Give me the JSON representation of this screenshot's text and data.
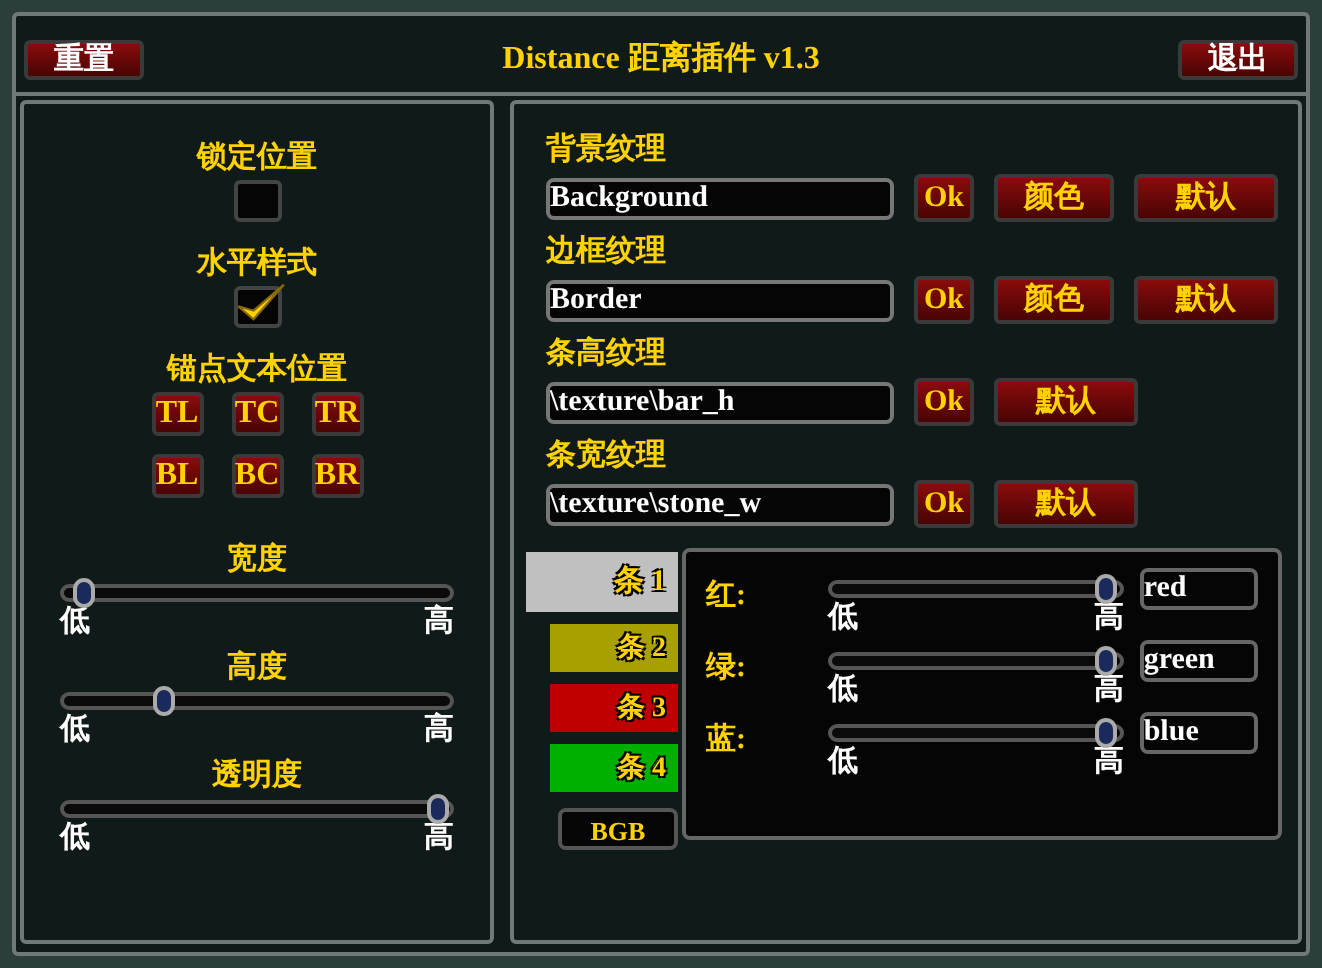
{
  "title": "Distance 距离插件 v1.3",
  "reset_button": "重置",
  "exit_button": "退出",
  "left": {
    "checkboxes": [
      {
        "label": "锁定位置",
        "checked": false
      },
      {
        "label": "水平样式",
        "checked": true
      }
    ],
    "anchor": {
      "label": "锚点文本位置",
      "buttons": [
        "TL",
        "TC",
        "TR",
        "BL",
        "BC",
        "BR"
      ]
    },
    "sliders": [
      {
        "label": "宽度",
        "low": "低",
        "high": "高",
        "level": 0.05
      },
      {
        "label": "高度",
        "low": "低",
        "high": "高",
        "level": 0.26
      },
      {
        "label": "透明度",
        "low": "低",
        "high": "高",
        "level": 0.97
      }
    ]
  },
  "textures": [
    {
      "label": "背景纹理",
      "value": "Background",
      "buttons": [
        "Ok",
        "颜色",
        "默认"
      ]
    },
    {
      "label": "边框纹理",
      "value": "Border",
      "buttons": [
        "Ok",
        "颜色",
        "默认"
      ]
    },
    {
      "label": "条高纹理",
      "value": "\\texture\\bar_h",
      "buttons": [
        "Ok",
        "默认"
      ]
    },
    {
      "label": "条宽纹理",
      "value": "\\texture\\stone_w",
      "buttons": [
        "Ok",
        "默认"
      ]
    }
  ],
  "bars": {
    "tabs": [
      {
        "label": "条 1",
        "color": "#c0c0c0",
        "selected": true
      },
      {
        "label": "条 2",
        "color": "#a8a000",
        "selected": false
      },
      {
        "label": "条 3",
        "color": "#c00000",
        "selected": false
      },
      {
        "label": "条 4",
        "color": "#00b000",
        "selected": false
      }
    ],
    "mode_button": "BGB"
  },
  "channels": [
    {
      "label": "红:",
      "low": "低",
      "high": "高",
      "level": 0.95,
      "value": "red"
    },
    {
      "label": "绿:",
      "low": "低",
      "high": "高",
      "level": 0.95,
      "value": "green"
    },
    {
      "label": "蓝:",
      "low": "低",
      "high": "高",
      "level": 0.95,
      "value": "blue"
    }
  ]
}
